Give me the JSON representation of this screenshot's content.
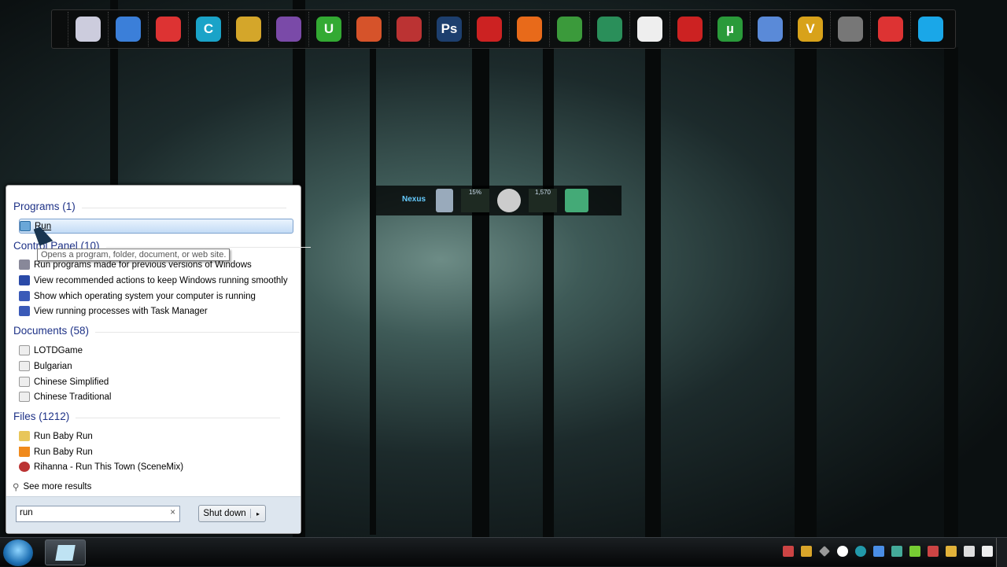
{
  "dock": {
    "icons": [
      "notepad-icon",
      "malwarebytes-icon",
      "blocked-icon",
      "ccleaner-icon",
      "keys-icon",
      "winrar-icon",
      "green-u-icon",
      "paint-icon",
      "tool-icon",
      "photoshop-icon",
      "red-ball-icon",
      "firefox-icon",
      "chrome-icon",
      "idm-icon",
      "search-icon",
      "download-icon",
      "utorrent-icon",
      "c-icon",
      "v-icon",
      "droplet-icon",
      "office-icon",
      "skype-icon"
    ],
    "labels": {
      "photoshop-icon": "Ps",
      "ccleaner-icon": "C",
      "green-u-icon": "U",
      "v-icon": "V",
      "utorrent-icon": "µ"
    }
  },
  "gadgets": {
    "logo": "Nexus",
    "cpu": "15%",
    "ram": "1,570"
  },
  "start_menu": {
    "programs_header": "Programs (1)",
    "programs": [
      "Run"
    ],
    "tooltip": "Opens a program, folder, document, or web site.",
    "control_panel_header": "Control Panel (10)",
    "control_panel": [
      "Run programs made for previous versions of Windows",
      "View recommended actions to keep Windows running smoothly",
      "Show which operating system your computer is running",
      "View running processes with Task Manager"
    ],
    "documents_header": "Documents (58)",
    "documents": [
      "LOTDGame",
      "Bulgarian",
      "Chinese Simplified",
      "Chinese Traditional"
    ],
    "files_header": "Files (1212)",
    "files": [
      "Run Baby Run",
      "Run Baby Run",
      "Rihanna  - Run This Town (SceneMix)"
    ],
    "see_more": "See more results",
    "search_value": "run",
    "clear": "×",
    "shutdown": "Shut down",
    "shutdown_arrow": "▸"
  },
  "colors": {
    "accent": "#1e3287",
    "selection": "#c4dcf6"
  }
}
